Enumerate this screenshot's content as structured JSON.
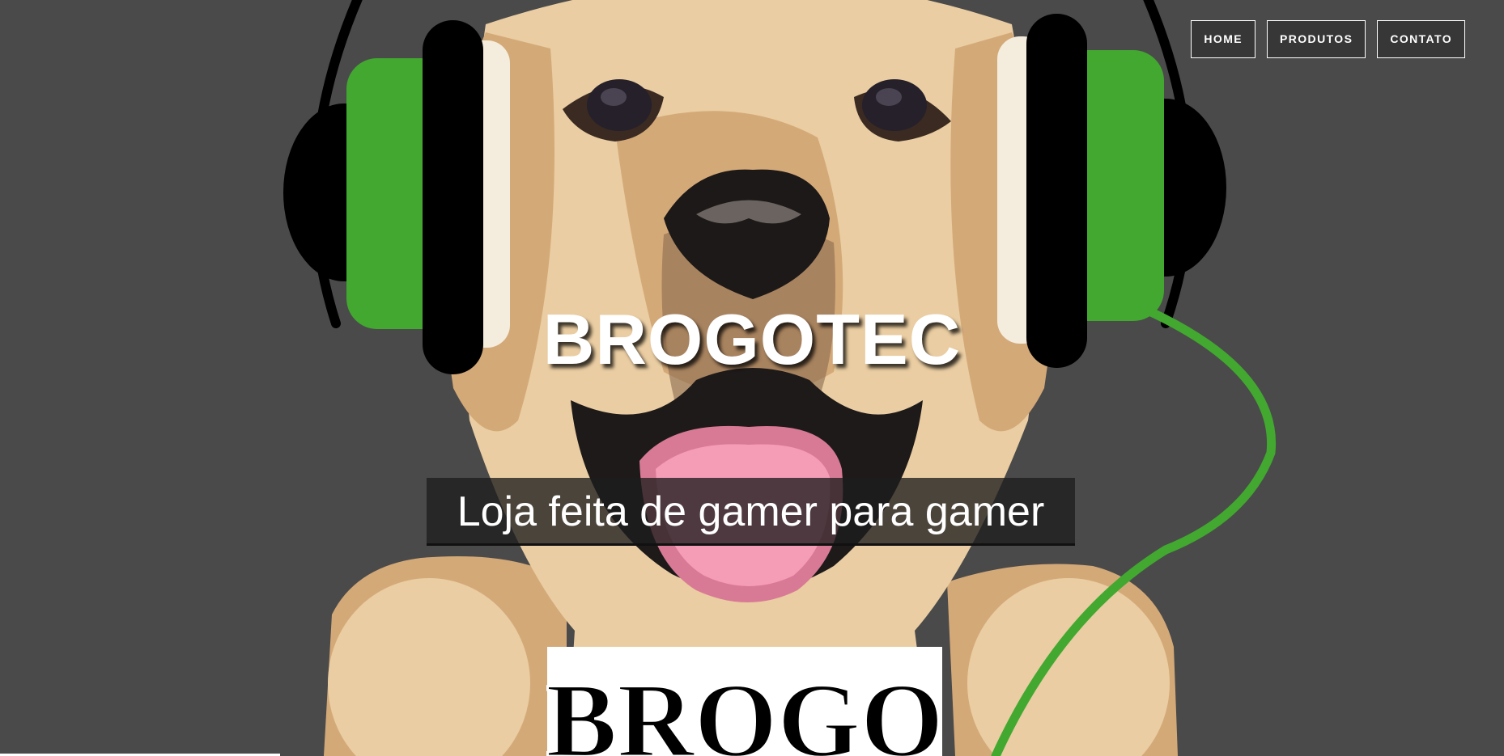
{
  "nav": {
    "items": [
      {
        "label": "HOME"
      },
      {
        "label": "PRODUTOS"
      },
      {
        "label": "CONTATO"
      }
    ]
  },
  "hero": {
    "title": "BROGOTEC",
    "tagline": "Loja feita de gamer para gamer",
    "shirt_text": "BROGO",
    "illustration": "dog-with-headphones-mascot"
  },
  "colors": {
    "background": "#4a4a4a",
    "accent_green": "#42a830",
    "fur_light": "#eacda2",
    "fur_mid": "#d4a978",
    "fur_dark": "#8b6a4e",
    "tongue": "#f59cb7",
    "text": "#ffffff"
  }
}
